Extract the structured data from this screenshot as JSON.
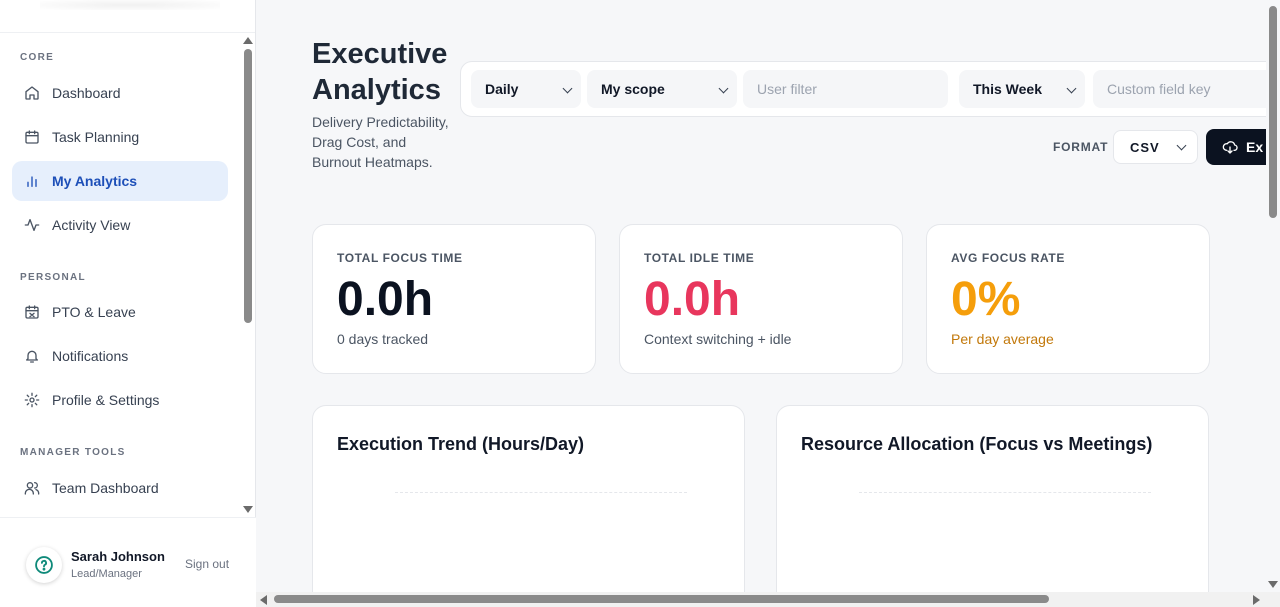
{
  "sidebar": {
    "sections": [
      {
        "label": "CORE"
      },
      {
        "label": "PERSONAL"
      },
      {
        "label": "MANAGER TOOLS"
      }
    ],
    "items": [
      {
        "label": "Dashboard",
        "icon": "home-icon"
      },
      {
        "label": "Task Planning",
        "icon": "calendar-icon"
      },
      {
        "label": "My Analytics",
        "icon": "bar-chart-icon",
        "active": true
      },
      {
        "label": "Activity View",
        "icon": "activity-icon"
      },
      {
        "label": "PTO & Leave",
        "icon": "calendar-off-icon"
      },
      {
        "label": "Notifications",
        "icon": "bell-icon"
      },
      {
        "label": "Profile & Settings",
        "icon": "gear-icon"
      },
      {
        "label": "Team Dashboard",
        "icon": "users-icon"
      }
    ],
    "user": {
      "name": "Sarah Johnson",
      "role": "Lead/Manager",
      "sign_out": "Sign out",
      "avatar_icon": "help-circle-icon"
    }
  },
  "header": {
    "title": "Executive Analytics",
    "subtitle": "Delivery Predictability, Drag Cost, and Burnout Heatmaps."
  },
  "filters": {
    "granularity": "Daily",
    "scope": "My scope",
    "user_filter_placeholder": "User filter",
    "range": "This Week",
    "custom_field_placeholder": "Custom field key"
  },
  "export": {
    "format_label": "FORMAT",
    "format_value": "CSV",
    "button_label": "Ex"
  },
  "stats": [
    {
      "label": "TOTAL FOCUS TIME",
      "value": "0.0h",
      "note": "0 days tracked",
      "value_color": "#0b1220",
      "note_color": "#4b5563"
    },
    {
      "label": "TOTAL IDLE TIME",
      "value": "0.0h",
      "note": "Context switching + idle",
      "value_color": "#e11d48",
      "note_color": "#4b5563"
    },
    {
      "label": "AVG FOCUS RATE",
      "value": "0%",
      "note": "Per day average",
      "value_color": "#f59e0b",
      "note_color": "#c2780a"
    }
  ],
  "charts": [
    {
      "title": "Execution Trend (Hours/Day)"
    },
    {
      "title": "Resource Allocation (Focus vs Meetings)"
    }
  ],
  "colors": {
    "accent": "#1d4fb8",
    "active_bg": "#e6effc",
    "export_bg": "#0b1220"
  }
}
